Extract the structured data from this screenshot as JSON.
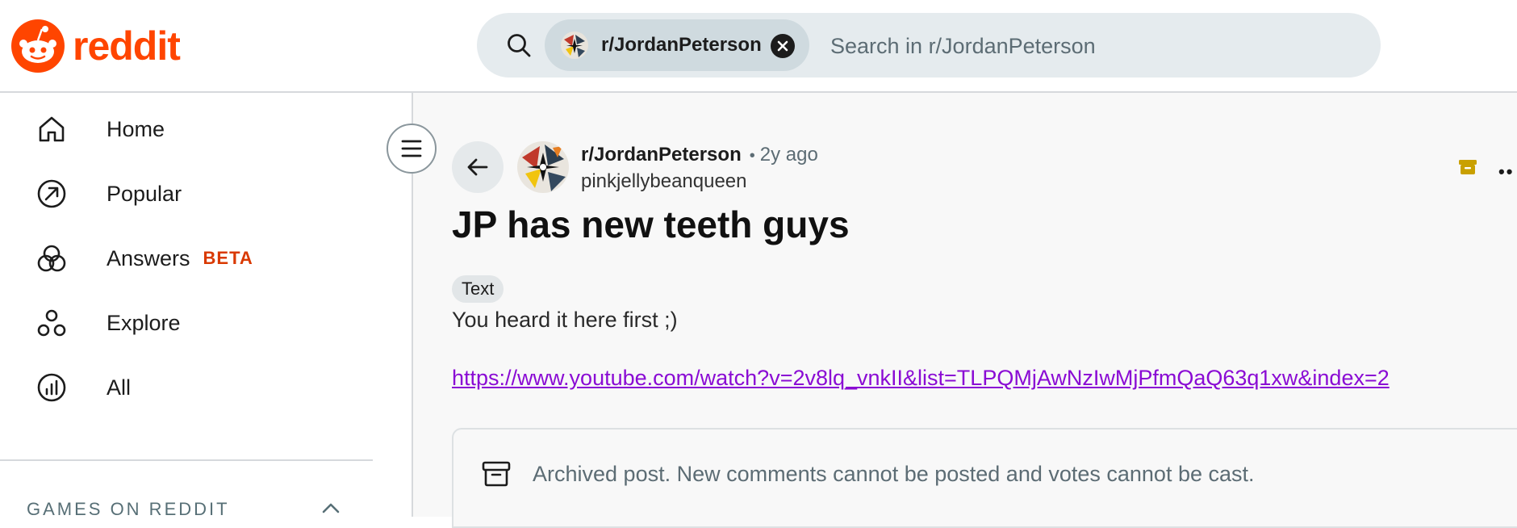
{
  "brand": {
    "name": "reddit",
    "color": "#ff4500"
  },
  "search": {
    "chip_label": "r/JordanPeterson",
    "placeholder": "Search in r/JordanPeterson"
  },
  "sidebar": {
    "items": [
      {
        "label": "Home",
        "icon": "home-icon"
      },
      {
        "label": "Popular",
        "icon": "popular-icon"
      },
      {
        "label": "Answers",
        "icon": "answers-icon",
        "badge": "BETA"
      },
      {
        "label": "Explore",
        "icon": "explore-icon"
      },
      {
        "label": "All",
        "icon": "all-icon"
      }
    ],
    "section_title": "GAMES ON REDDIT"
  },
  "post": {
    "subreddit": "r/JordanPeterson",
    "separator": "•",
    "age": "2y ago",
    "author": "pinkjellybeanqueen",
    "title": "JP has new teeth guys",
    "flair": "Text",
    "body": "You heard it here first ;)",
    "link": "https://www.youtube.com/watch?v=2v8lq_vnkII&list=TLPQMjAwNzIwMjPfmQaQ63q1xw&index=2",
    "archived_notice": "Archived post. New comments cannot be posted and votes cannot be cast.",
    "more_label": "••"
  },
  "colors": {
    "beta": "#d93900",
    "link": "#8a0bd4",
    "archive_icon": "#b8860b"
  }
}
